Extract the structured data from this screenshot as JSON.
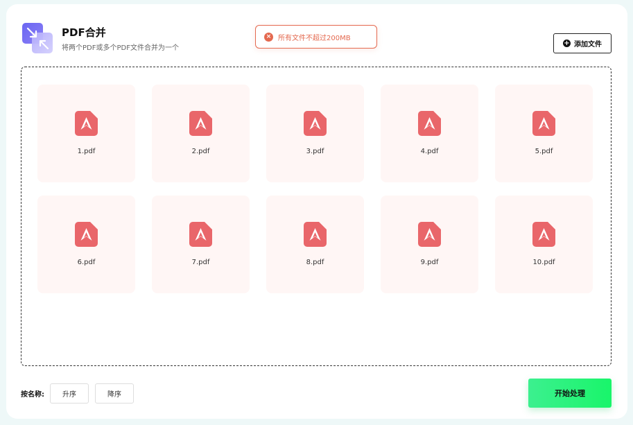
{
  "header": {
    "title": "PDF合并",
    "subtitle": "将两个PDF或多个PDF文件合并为一个",
    "logo_icon": "merge-arrows-icon"
  },
  "toast": {
    "message": "所有文件不超过200MB",
    "icon": "error-circle-icon",
    "color": "#e4694f"
  },
  "toolbar": {
    "add_label": "添加文件",
    "add_icon": "plus-circle-icon"
  },
  "files": [
    {
      "name": "1.pdf"
    },
    {
      "name": "2.pdf"
    },
    {
      "name": "3.pdf"
    },
    {
      "name": "4.pdf"
    },
    {
      "name": "5.pdf"
    },
    {
      "name": "6.pdf"
    },
    {
      "name": "7.pdf"
    },
    {
      "name": "8.pdf"
    },
    {
      "name": "9.pdf"
    },
    {
      "name": "10.pdf"
    }
  ],
  "sort": {
    "label": "按名称:",
    "asc_label": "升序",
    "desc_label": "降序"
  },
  "actions": {
    "start_label": "开始处理"
  },
  "colors": {
    "accent_green": "#19f56a",
    "pdf_red": "#e9666a",
    "tile_bg": "#fff6f5"
  }
}
